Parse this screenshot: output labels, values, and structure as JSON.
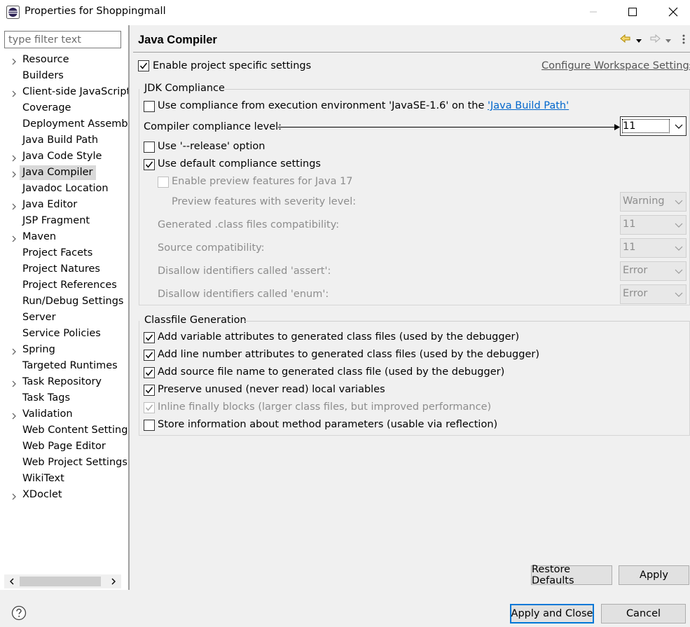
{
  "window": {
    "title": "Properties for Shoppingmall",
    "icon": "eclipse-icon"
  },
  "filter": {
    "placeholder": "type filter text",
    "value": ""
  },
  "tree": {
    "items": [
      {
        "label": "Resource",
        "expandable": true
      },
      {
        "label": "Builders",
        "expandable": false
      },
      {
        "label": "Client-side JavaScript",
        "expandable": true
      },
      {
        "label": "Coverage",
        "expandable": false
      },
      {
        "label": "Deployment Assembly",
        "expandable": false
      },
      {
        "label": "Java Build Path",
        "expandable": false
      },
      {
        "label": "Java Code Style",
        "expandable": true
      },
      {
        "label": "Java Compiler",
        "expandable": true,
        "selected": true
      },
      {
        "label": "Javadoc Location",
        "expandable": false
      },
      {
        "label": "Java Editor",
        "expandable": true
      },
      {
        "label": "JSP Fragment",
        "expandable": false
      },
      {
        "label": "Maven",
        "expandable": true
      },
      {
        "label": "Project Facets",
        "expandable": false
      },
      {
        "label": "Project Natures",
        "expandable": false
      },
      {
        "label": "Project References",
        "expandable": false
      },
      {
        "label": "Run/Debug Settings",
        "expandable": false
      },
      {
        "label": "Server",
        "expandable": false
      },
      {
        "label": "Service Policies",
        "expandable": false
      },
      {
        "label": "Spring",
        "expandable": true
      },
      {
        "label": "Targeted Runtimes",
        "expandable": false
      },
      {
        "label": "Task Repository",
        "expandable": true
      },
      {
        "label": "Task Tags",
        "expandable": false
      },
      {
        "label": "Validation",
        "expandable": true
      },
      {
        "label": "Web Content Settings",
        "expandable": false
      },
      {
        "label": "Web Page Editor",
        "expandable": false
      },
      {
        "label": "Web Project Settings",
        "expandable": false
      },
      {
        "label": "WikiText",
        "expandable": false
      },
      {
        "label": "XDoclet",
        "expandable": true
      }
    ]
  },
  "page": {
    "title": "Java Compiler",
    "enable_project_specific": {
      "label": "Enable project specific settings",
      "checked": true
    },
    "configure_workspace": "Configure Workspace Settings..."
  },
  "jdk": {
    "group_title": "JDK Compliance",
    "use_env": {
      "prefix": "Use compliance from execution environment 'JavaSE-1.6' on the ",
      "link": "'Java Build Path'",
      "checked": false
    },
    "compliance_label": "Compiler compliance level:",
    "compliance_value": "11",
    "release": {
      "label": "Use '--release' option",
      "checked": false
    },
    "use_default": {
      "label": "Use default compliance settings",
      "checked": true
    },
    "preview": {
      "label": "Enable preview features for Java 17",
      "checked": false
    },
    "preview_severity": {
      "label": "Preview features with severity level:",
      "value": "Warning"
    },
    "generated": {
      "label": "Generated .class files compatibility:",
      "value": "11"
    },
    "source": {
      "label": "Source compatibility:",
      "value": "11"
    },
    "assert_id": {
      "label": "Disallow identifiers called 'assert':",
      "value": "Error"
    },
    "enum_id": {
      "label": "Disallow identifiers called 'enum':",
      "value": "Error"
    }
  },
  "classfile": {
    "group_title": "Classfile Generation",
    "items": [
      {
        "label": "Add variable attributes to generated class files (used by the debugger)",
        "checked": true,
        "disabled": false
      },
      {
        "label": "Add line number attributes to generated class files (used by the debugger)",
        "checked": true,
        "disabled": false
      },
      {
        "label": "Add source file name to generated class file (used by the debugger)",
        "checked": true,
        "disabled": false
      },
      {
        "label": "Preserve unused (never read) local variables",
        "checked": true,
        "disabled": false
      },
      {
        "label": "Inline finally blocks (larger class files, but improved performance)",
        "checked": true,
        "disabled": true
      },
      {
        "label": "Store information about method parameters (usable via reflection)",
        "checked": false,
        "disabled": false
      }
    ]
  },
  "buttons": {
    "restore_defaults": "Restore Defaults",
    "apply": "Apply",
    "apply_close": "Apply and Close",
    "cancel": "Cancel"
  },
  "colors": {
    "link": "#0066cc",
    "default_button_border": "#0078d7",
    "nav_arrow": "#d9a400"
  }
}
